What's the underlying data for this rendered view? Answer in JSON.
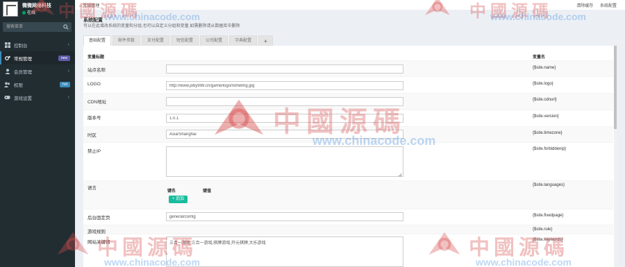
{
  "sidebar": {
    "user_name": "微微网络科技",
    "status": "在线",
    "search_placeholder": "搜索菜单",
    "items": [
      {
        "label": "控制台",
        "badge": "",
        "chevron": "‹"
      },
      {
        "label": "常规管理",
        "badge": "new",
        "chevron": ""
      },
      {
        "label": "会员管理",
        "badge": "",
        "chevron": "‹"
      },
      {
        "label": "权限",
        "badge": "hot",
        "chevron": ""
      },
      {
        "label": "游戏设置",
        "badge": "",
        "chevron": "‹"
      }
    ]
  },
  "header": {
    "breadcrumb": "常规管理",
    "links": [
      "清除缓存",
      "系统配置"
    ]
  },
  "page": {
    "title": "系统配置",
    "description": "可以在此增改系统的变量和分组,也可以自定义分组和变量,如需删除请从数据库中删除"
  },
  "tabs": [
    "基础配置",
    "邮件参数",
    "支付配置",
    "短信配置",
    "公司配置",
    "字典配置",
    "+"
  ],
  "table": {
    "header_label": "变量标题",
    "header_var": "变量名",
    "rows": [
      {
        "label": "站点名称",
        "value": "",
        "var": "{$site.name}"
      },
      {
        "label": "LOGO",
        "value": "http://www.joby999.cn/game/logo/nohelmg.jpg",
        "var": "{$site.logo}"
      },
      {
        "label": "CDN地址",
        "value": "",
        "var": "{$site.cdnurl}"
      },
      {
        "label": "版本号",
        "value": "1.0.1",
        "var": "{$site.version}"
      },
      {
        "label": "时区",
        "value": "Asia/Shanghai",
        "var": "{$site.timezone}"
      },
      {
        "label": "禁止IP",
        "value": "",
        "var": "{$site.forbiddenip}"
      },
      {
        "label": "语言",
        "value": "",
        "var": "{$site.languages}"
      },
      {
        "label": "后台固定页",
        "value": "general/config",
        "var": "{$site.fixedpage}"
      },
      {
        "label": "游戏规则",
        "value": "",
        "var": "{$site.rule}"
      },
      {
        "label": "网站关键词",
        "value": "三合一游戏,三合一游戏,棋牌游戏,开元棋牌,大乐游戏",
        "var": "{$site.keywords}"
      }
    ],
    "lang_key": "键名",
    "lang_value": "键值",
    "add_button": "+ 追加"
  },
  "watermark": {
    "brand": "中國源碼",
    "url": "www.chinacode.com",
    "color": "#d64c4c",
    "url_color": "#468cdc"
  }
}
